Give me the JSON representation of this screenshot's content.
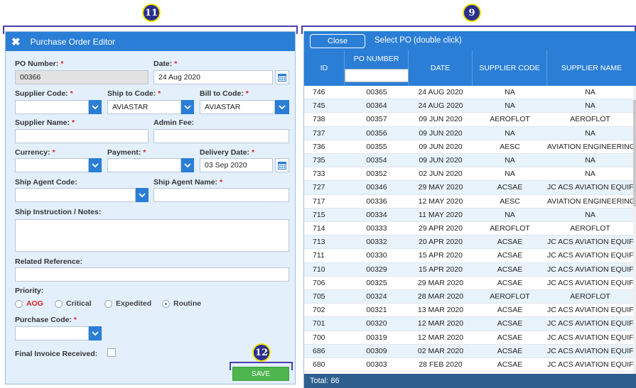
{
  "callouts": {
    "left": "11",
    "right": "9",
    "save": "12"
  },
  "editor": {
    "title": "Purchase Order Editor",
    "po_number_label": "PO Number:",
    "po_number_value": "00366",
    "date_label": "Date:",
    "date_value": "24 Aug 2020",
    "supplier_code_label": "Supplier Code:",
    "ship_to_code_label": "Ship to Code:",
    "ship_to_code_value": "AVIASTAR",
    "bill_to_code_label": "Bill to Code:",
    "bill_to_code_value": "AVIASTAR",
    "supplier_name_label": "Supplier Name:",
    "admin_fee_label": "Admin Fee:",
    "currency_label": "Currency:",
    "payment_label": "Payment:",
    "delivery_date_label": "Delivery Date:",
    "delivery_date_value": "03 Sep 2020",
    "ship_agent_code_label": "Ship Agent Code:",
    "ship_agent_name_label": "Ship Agent Name:",
    "ship_instruction_label": "Ship Instruction / Notes:",
    "related_reference_label": "Related Reference:",
    "priority_label": "Priority:",
    "priority_options": [
      "AOG",
      "Critical",
      "Expedited",
      "Routine"
    ],
    "priority_selected": "Routine",
    "purchase_code_label": "Purchase Code:",
    "final_invoice_label": "Final Invoice Received:",
    "save_label": "SAVE",
    "required_mark": "*"
  },
  "selector": {
    "close_label": "Close",
    "title": "Select PO (double click)",
    "columns": [
      "ID",
      "PO NUMBER",
      "DATE",
      "SUPPLIER CODE",
      "SUPPLIER NAME"
    ],
    "rows": [
      [
        "746",
        "00365",
        "24 AUG 2020",
        "NA",
        "NA"
      ],
      [
        "745",
        "00364",
        "24 AUG 2020",
        "NA",
        "NA"
      ],
      [
        "738",
        "00357",
        "09 JUN 2020",
        "AEROFLOT",
        "AEROFLOT"
      ],
      [
        "737",
        "00356",
        "09 JUN 2020",
        "NA",
        "NA"
      ],
      [
        "736",
        "00355",
        "09 JUN 2020",
        "AESC",
        "AVIATION ENGINEERING"
      ],
      [
        "735",
        "00354",
        "09 JUN 2020",
        "NA",
        "NA"
      ],
      [
        "733",
        "00352",
        "02 JUN 2020",
        "NA",
        "NA"
      ],
      [
        "727",
        "00346",
        "29 MAY 2020",
        "ACSAE",
        "JC ACS AVIATION EQUIF"
      ],
      [
        "717",
        "00336",
        "12 MAY 2020",
        "AESC",
        "AVIATION ENGINEERING"
      ],
      [
        "715",
        "00334",
        "11 MAY 2020",
        "NA",
        "NA"
      ],
      [
        "714",
        "00333",
        "29 APR 2020",
        "AEROFLOT",
        "AEROFLOT"
      ],
      [
        "713",
        "00332",
        "20 APR 2020",
        "ACSAE",
        "JC ACS AVIATION EQUIF"
      ],
      [
        "711",
        "00330",
        "15 APR 2020",
        "ACSAE",
        "JC ACS AVIATION EQUIF"
      ],
      [
        "710",
        "00329",
        "15 APR 2020",
        "ACSAE",
        "JC ACS AVIATION EQUIF"
      ],
      [
        "706",
        "00325",
        "29 MAR 2020",
        "ACSAE",
        "JC ACS AVIATION EQUIF"
      ],
      [
        "705",
        "00324",
        "28 MAR 2020",
        "AEROFLOT",
        "AEROFLOT"
      ],
      [
        "702",
        "00321",
        "13 MAR 2020",
        "ACSAE",
        "JC ACS AVIATION EQUIF"
      ],
      [
        "701",
        "00320",
        "12 MAR 2020",
        "ACSAE",
        "JC ACS AVIATION EQUIF"
      ],
      [
        "700",
        "00319",
        "12 MAR 2020",
        "ACSAE",
        "JC ACS AVIATION EQUIF"
      ],
      [
        "686",
        "00309",
        "02 MAR 2020",
        "ACSAE",
        "JC ACS AVIATION EQUIF"
      ],
      [
        "680",
        "00303",
        "28 FEB 2020",
        "ACSAE",
        "JC ACS AVIATION EQUIF"
      ]
    ],
    "footer": "Total: 86"
  },
  "colors": {
    "accent": "#2a7ed6",
    "panel_bg": "#e3f0fc",
    "save_green": "#4fb54f",
    "footer": "#2e5f8f",
    "required": "#e02020"
  },
  "icons": {
    "close": "close-icon",
    "dropdown": "chevron-down-icon",
    "calendar": "calendar-icon"
  }
}
